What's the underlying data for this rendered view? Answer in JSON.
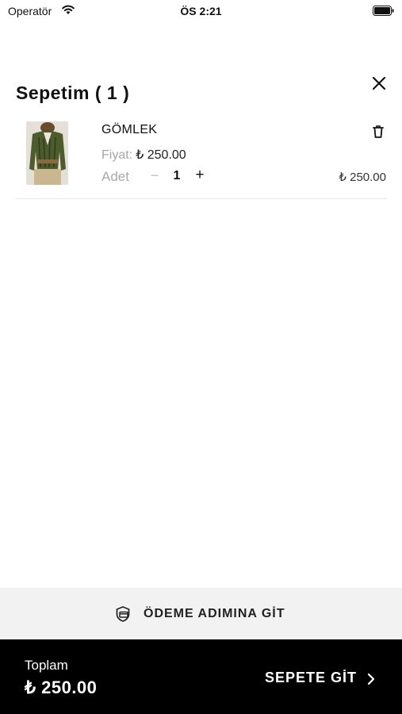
{
  "status_bar": {
    "carrier": "Operatör",
    "time": "ÖS 2:21"
  },
  "cart": {
    "title": "Sepetim ( 1 )",
    "items": [
      {
        "name": "GÖMLEK",
        "price_label": "Fiyat:",
        "price": "₺ 250.00",
        "qty_label": "Adet",
        "qty_minus": "−",
        "quantity": "1",
        "qty_plus": "+",
        "line_total": "₺ 250.00"
      }
    ]
  },
  "checkout": {
    "label": "ÖDEME ADIMINA GİT"
  },
  "footer": {
    "total_label": "Toplam",
    "total_value": "₺ 250.00",
    "go_cart_label": "SEPETE GİT"
  },
  "colors": {
    "footer_bg": "#000000",
    "checkout_bg": "#f2f2f2",
    "muted_text": "#a7a7a7",
    "divider": "#e4e4e4"
  },
  "icons": [
    "wifi-icon",
    "battery-icon",
    "close-icon",
    "trash-icon",
    "payment-card-icon",
    "chevron-right-icon"
  ]
}
